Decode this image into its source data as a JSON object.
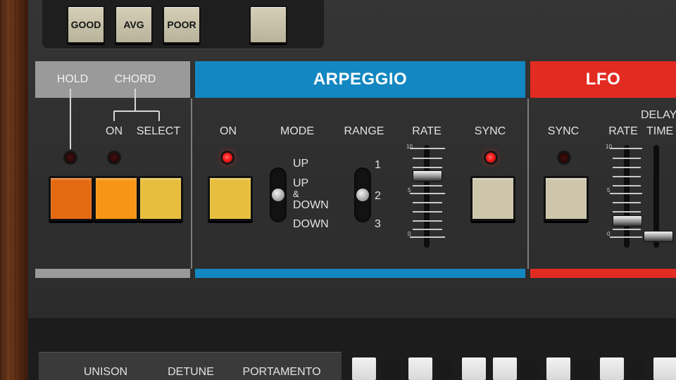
{
  "top_buttons": {
    "good": "GOOD",
    "avg": "AVG",
    "poor": "POOR",
    "blank": ""
  },
  "hold_chord": {
    "hold": "HOLD",
    "chord": "CHORD",
    "on": "ON",
    "select": "SELECT",
    "colors": [
      "#e46a12",
      "#f79616",
      "#e7be3d"
    ]
  },
  "arpeggio": {
    "title": "ARPEGGIO",
    "on": "ON",
    "mode": "MODE",
    "mode_options": [
      "UP",
      "UP",
      "&",
      "DOWN",
      "DOWN"
    ],
    "mode_selected": "UP & DOWN",
    "range": "RANGE",
    "range_options": [
      "1",
      "2",
      "3"
    ],
    "range_selected": "2",
    "rate": "RATE",
    "rate_level": 0.8,
    "sync": "SYNC",
    "scale": [
      "10",
      "5",
      "0"
    ],
    "color": "#1287c1"
  },
  "lfo": {
    "title": "LFO",
    "sync": "SYNC",
    "rate": "RATE",
    "delay": "DELAY",
    "time": "TIME",
    "rate_level": 0.15,
    "delay_level": 0.05,
    "scale": [
      "10",
      "5",
      "0"
    ],
    "color": "#e22b21"
  },
  "bottom": {
    "unison": "UNISON",
    "detune": "DETUNE",
    "portamento": "PORTAMENTO"
  }
}
